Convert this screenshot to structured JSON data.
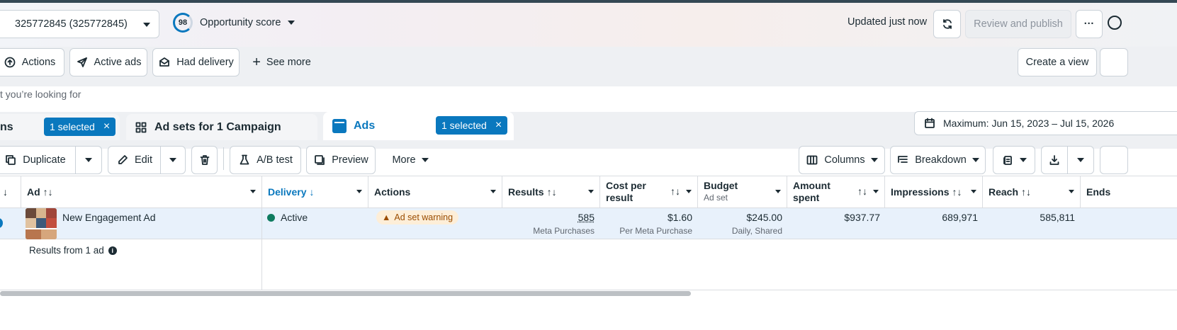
{
  "header": {
    "account_label": "325772845 (325772845)",
    "opportunity_score": "98",
    "opportunity_label": "Opportunity score",
    "updated_text": "Updated just now",
    "review_publish_label": "Review and publish",
    "more_label": "···"
  },
  "filters": {
    "actions_label": "Actions",
    "active_ads_label": "Active ads",
    "had_delivery_label": "Had delivery",
    "see_more_label": "See more",
    "create_view_label": "Create a view"
  },
  "search": {
    "placeholder_visible": "t you’re looking for"
  },
  "tabs": [
    {
      "label": "ns",
      "badge": "1 selected"
    },
    {
      "label": "Ad sets for 1 Campaign"
    },
    {
      "label": "Ads",
      "badge": "1 selected"
    }
  ],
  "date_range": "Maximum: Jun 15, 2023 – Jul 15, 2026",
  "toolbar": {
    "duplicate_label": "Duplicate",
    "edit_label": "Edit",
    "ab_test_label": "A/B test",
    "preview_label": "Preview",
    "more_label": "More",
    "columns_label": "Columns",
    "breakdown_label": "Breakdown"
  },
  "table": {
    "columns": {
      "ad": "Ad",
      "delivery": "Delivery",
      "actions": "Actions",
      "results": "Results",
      "cost_per_result_1": "Cost per",
      "cost_per_result_2": "result",
      "budget": "Budget",
      "budget_sub": "Ad set",
      "amount_spent_1": "Amount",
      "amount_spent_2": "spent",
      "impressions": "Impressions",
      "reach": "Reach",
      "ends": "Ends"
    },
    "row": {
      "ad_name": "New Engagement Ad",
      "delivery": "Active",
      "actions_warning": "Ad set warning",
      "results": "585",
      "results_sub": "Meta Purchases",
      "cost_per_result": "$1.60",
      "cost_per_result_sub": "Per Meta Purchase",
      "budget": "$245.00",
      "budget_sub": "Daily, Shared",
      "amount_spent": "$937.77",
      "impressions": "689,971",
      "reach": "585,811"
    },
    "footer": "Results from 1 ad"
  },
  "colors": {
    "accent": "#0a78be",
    "active_green": "#0f7b5f",
    "warning_bg": "#fdeed8",
    "row_selected": "#e8f1fb"
  }
}
